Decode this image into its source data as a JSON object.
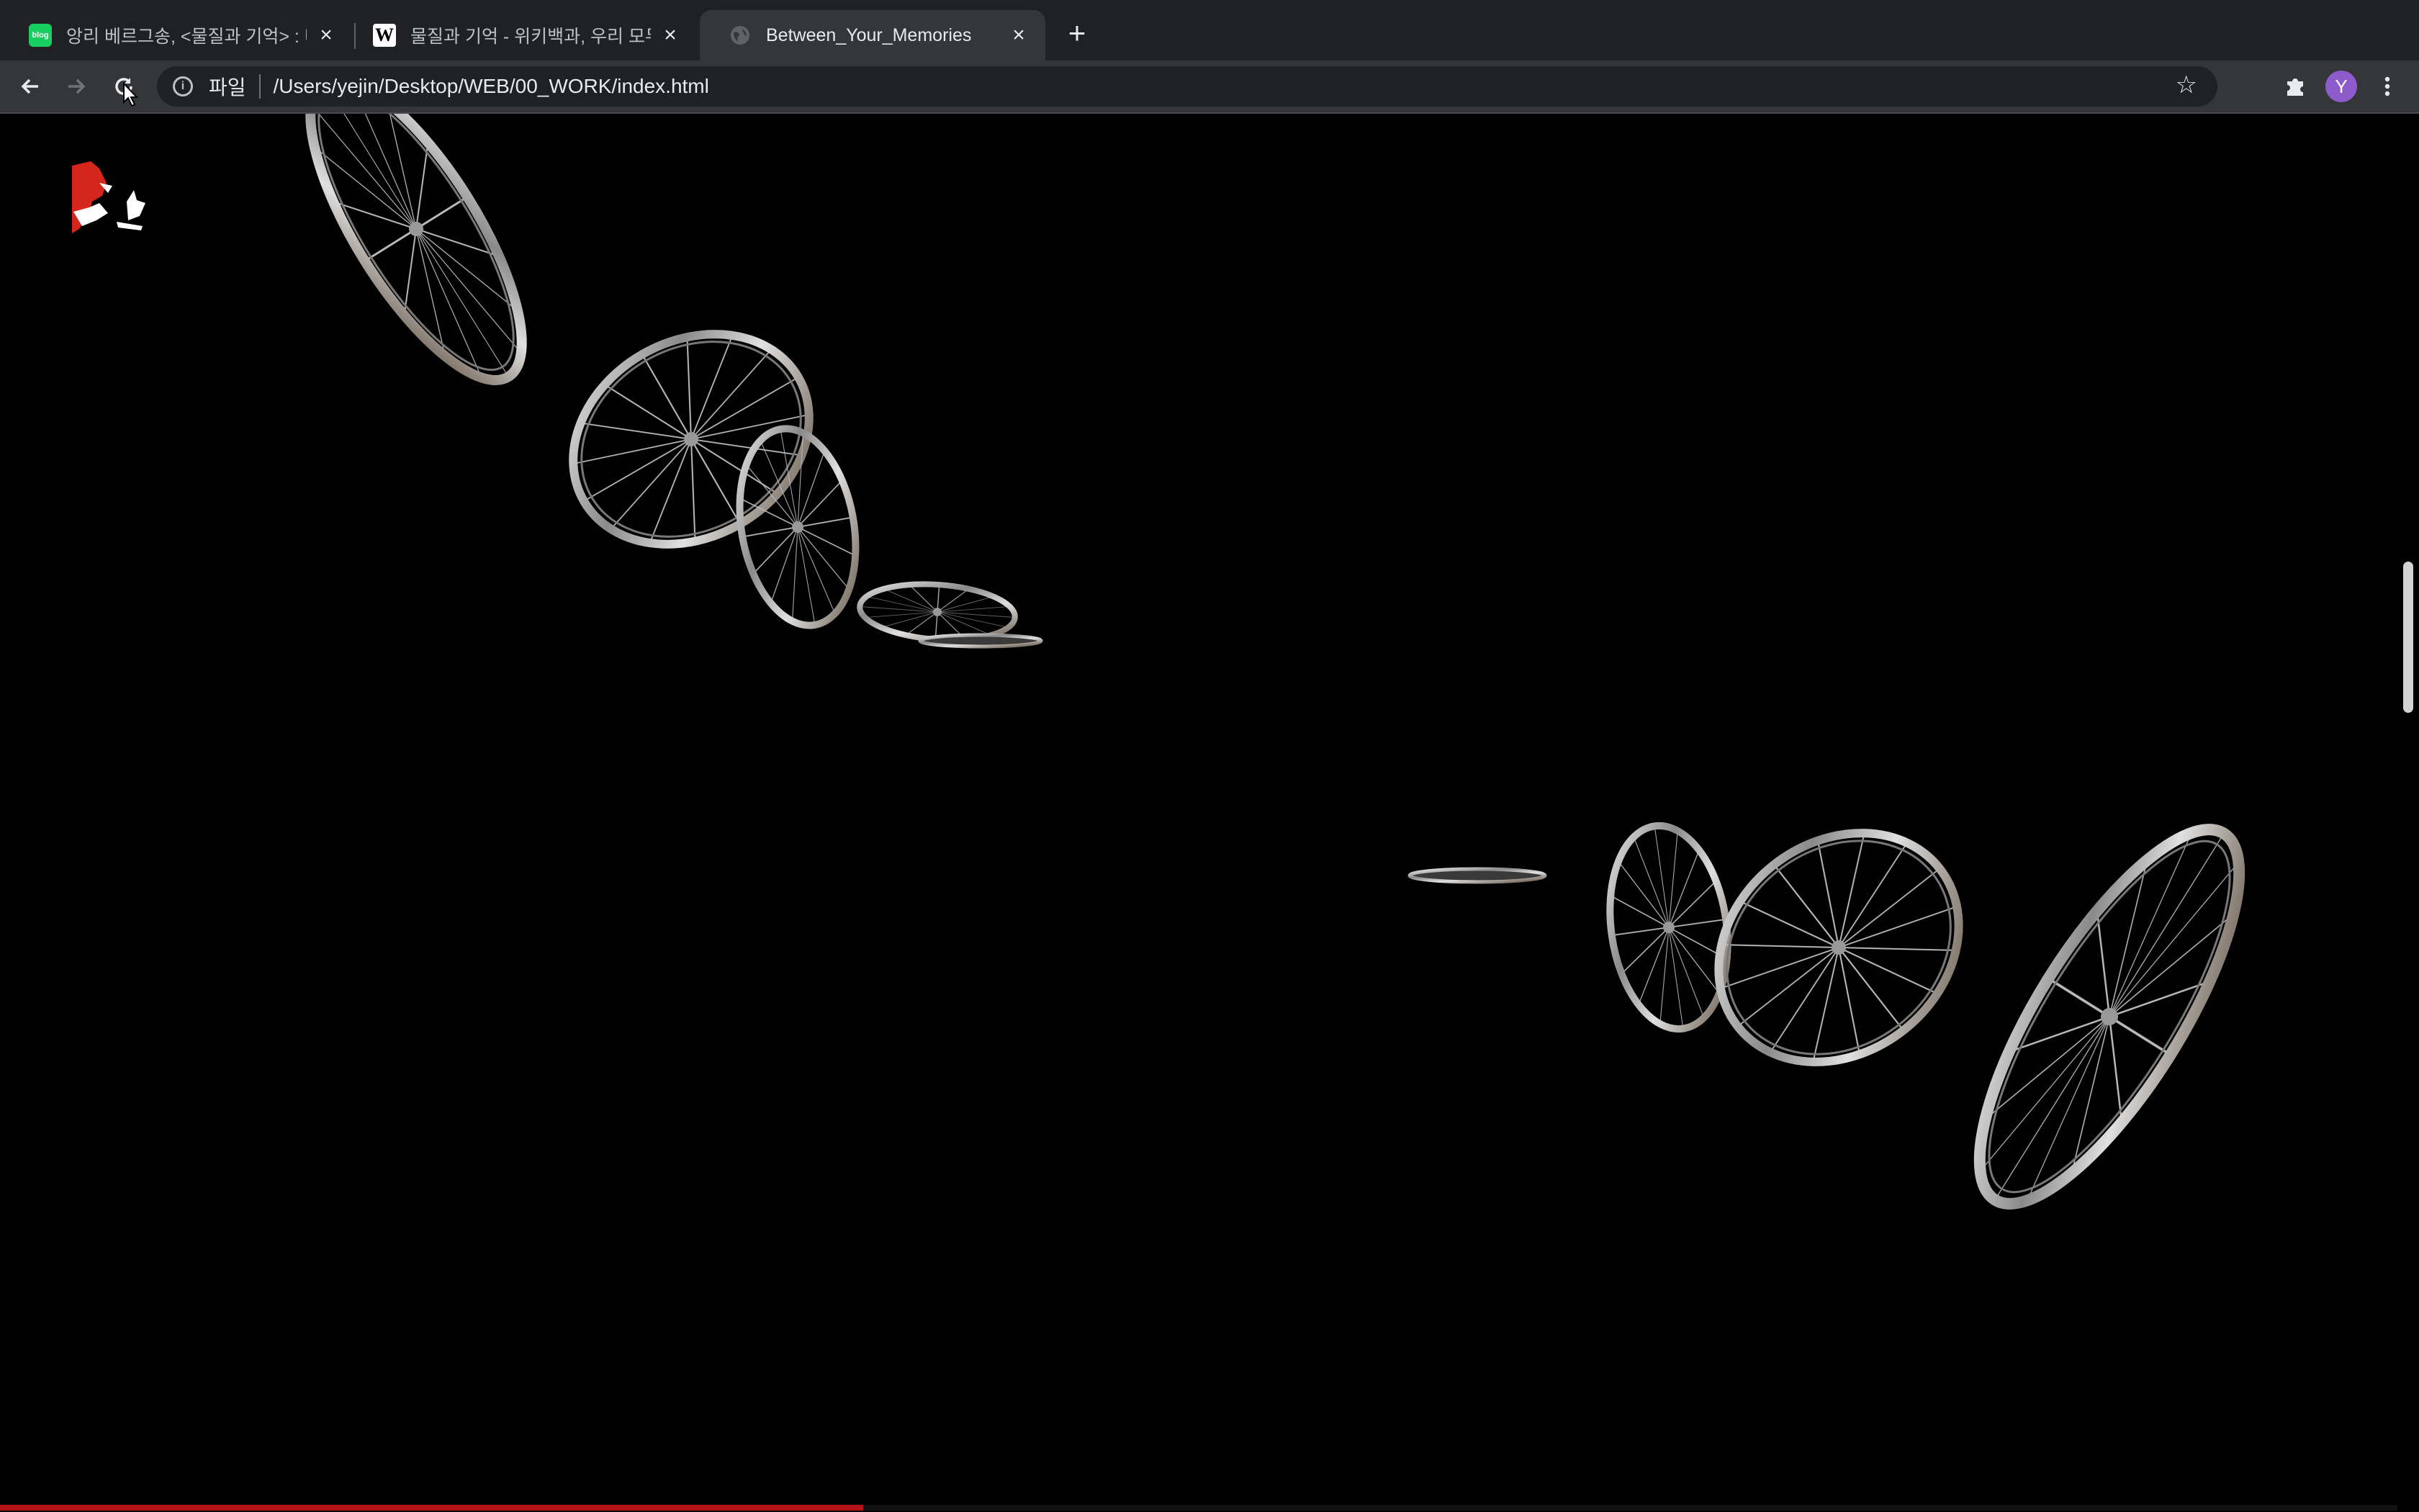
{
  "browser": {
    "tabs": [
      {
        "title": "앙리 베르그송, <물질과 기억> : 네이",
        "favicon": "naver-blog-icon",
        "favicon_text": "blog",
        "active": false
      },
      {
        "title": "물질과 기억 - 위키백과, 우리 모두의",
        "favicon": "wikipedia-icon",
        "favicon_text": "W",
        "active": false
      },
      {
        "title": "Between_Your_Memories",
        "favicon": "globe-icon",
        "favicon_text": "",
        "active": true
      }
    ],
    "new_tab_icon": "plus-icon",
    "omnibox": {
      "scheme_label": "파일",
      "url": "/Users/yejin/Desktop/WEB/00_WORK/index.html"
    },
    "profile_initial": "Y",
    "colors": {
      "tabstrip": "#202124",
      "toolbar": "#35363a",
      "omnibox": "#202124",
      "avatar": "#8e5bcb"
    }
  },
  "page": {
    "background": "#000000",
    "logo": "red-white-logo-mark",
    "content": "rolling-bicycle-wheels",
    "progress": 0.36,
    "progress_color": "#b31217"
  }
}
